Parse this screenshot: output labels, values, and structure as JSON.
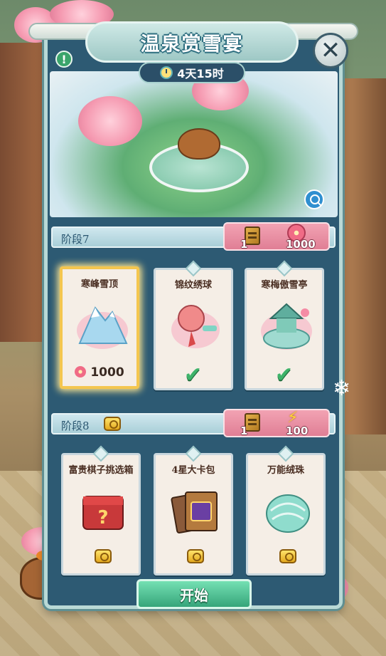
{
  "event": {
    "title": "温泉赏雪宴",
    "timer": "4天15时"
  },
  "stages": [
    {
      "label": "阶段7",
      "cost_tickets": "1",
      "cost_blossoms": "1000",
      "rewards": [
        {
          "name": "寒峰雪顶",
          "price": "1000",
          "status": "selected"
        },
        {
          "name": "锦纹绣球",
          "status": "claimed"
        },
        {
          "name": "寒梅傲雪亭",
          "status": "claimed"
        }
      ]
    },
    {
      "label": "阶段8",
      "cost_tickets": "1",
      "cost_energy": "100",
      "rewards": [
        {
          "name": "富贵棋子挑选箱",
          "status": "locked"
        },
        {
          "name": "4星大卡包",
          "status": "locked"
        },
        {
          "name": "万能绒珠",
          "status": "locked"
        }
      ]
    }
  ],
  "buttons": {
    "start": "开始",
    "close": "✕",
    "info": "!"
  },
  "colors": {
    "panel": "#2d5a73",
    "ribbon": "#e07f95",
    "start": "#36a57a",
    "selected_border": "#f4c64f",
    "check": "#3eb36a"
  }
}
